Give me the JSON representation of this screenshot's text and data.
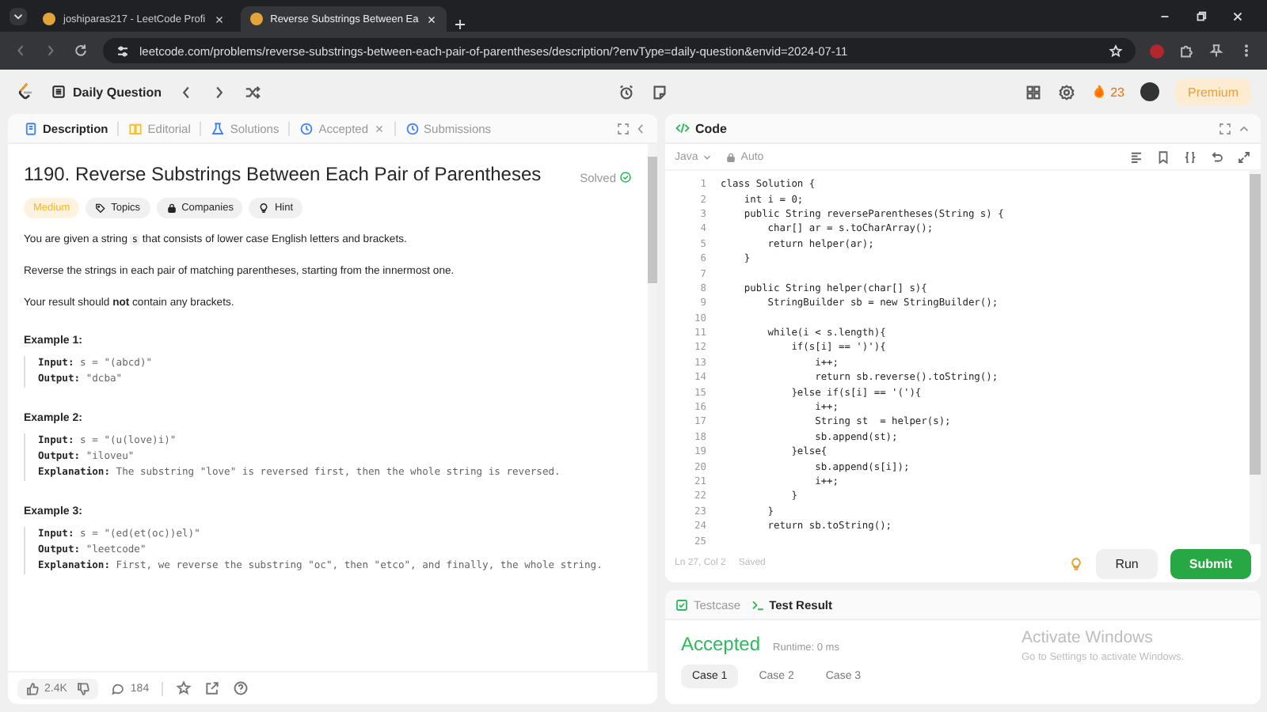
{
  "browser": {
    "tabs": [
      {
        "title": "joshiparas217 - LeetCode Profi",
        "selected": false
      },
      {
        "title": "Reverse Substrings Between Ea",
        "selected": true
      }
    ],
    "url": "leetcode.com/problems/reverse-substrings-between-each-pair-of-parentheses/description/?envType=daily-question&envid=2024-07-11"
  },
  "nav": {
    "title": "Daily Question",
    "streak": "23",
    "premium": "Premium"
  },
  "description_panel": {
    "tabs": [
      {
        "label": "Description",
        "selected": true,
        "closable": false
      },
      {
        "label": "Editorial",
        "selected": false,
        "closable": false
      },
      {
        "label": "Solutions",
        "selected": false,
        "closable": false
      },
      {
        "label": "Accepted",
        "selected": false,
        "closable": true
      },
      {
        "label": "Submissions",
        "selected": false,
        "closable": false
      }
    ],
    "title": "1190. Reverse Substrings Between Each Pair of Parentheses",
    "status": "Solved",
    "tags": [
      {
        "label": "Medium",
        "kind": "difficulty"
      },
      {
        "label": "Topics",
        "kind": "topics"
      },
      {
        "label": "Companies",
        "kind": "companies"
      },
      {
        "label": "Hint",
        "kind": "hint"
      }
    ],
    "paragraphs": [
      [
        {
          "kind": "text",
          "text": "You are given a string "
        },
        {
          "kind": "code",
          "text": "s"
        },
        {
          "kind": "text",
          "text": " that consists of lower case English letters and brackets."
        }
      ],
      [
        {
          "kind": "text",
          "text": "Reverse the strings in each pair of matching parentheses, starting from the innermost one."
        }
      ],
      [
        {
          "kind": "text",
          "text": "Your result should **not** contain any brackets."
        }
      ]
    ],
    "examples": [
      {
        "title": "Example 1:",
        "lines": [
          {
            "label": "Input:",
            "value": "s = \"(abcd)\""
          },
          {
            "label": "Output:",
            "value": "\"dcba\""
          }
        ]
      },
      {
        "title": "Example 2:",
        "lines": [
          {
            "label": "Input:",
            "value": "s = \"(u(love)i)\""
          },
          {
            "label": "Output:",
            "value": "\"iloveu\""
          },
          {
            "label": "Explanation:",
            "value": "The substring \"love\" is reversed first, then the whole string is reversed."
          }
        ]
      },
      {
        "title": "Example 3:",
        "lines": [
          {
            "label": "Input:",
            "value": "s = \"(ed(et(oc))el)\""
          },
          {
            "label": "Output:",
            "value": "\"leetcode\""
          },
          {
            "label": "Explanation:",
            "value": "First, we reverse the substring \"oc\", then \"etco\", and finally, the whole string."
          }
        ]
      }
    ],
    "footer": {
      "likes": "2.4K",
      "comments": "184"
    }
  },
  "code_panel": {
    "title": "Code",
    "language": "Java",
    "mode": "Auto",
    "lines": [
      {
        "number": "1",
        "text": "class Solution {"
      },
      {
        "number": "2",
        "text": "    int i = 0;"
      },
      {
        "number": "3",
        "text": "    public String reverseParentheses(String s) {"
      },
      {
        "number": "4",
        "text": "        char[] ar = s.toCharArray();"
      },
      {
        "number": "5",
        "text": "        return helper(ar);"
      },
      {
        "number": "6",
        "text": "    }"
      },
      {
        "number": "7"
      },
      {
        "number": "8",
        "text": "    public String helper(char[] s){"
      },
      {
        "number": "9",
        "text": "        StringBuilder sb = new StringBuilder();"
      },
      {
        "number": "10"
      },
      {
        "number": "11",
        "text": "        while(i < s.length){"
      },
      {
        "number": "12",
        "text": "            if(s[i] == ')'){"
      },
      {
        "number": "13",
        "text": "                i++;"
      },
      {
        "number": "14",
        "text": "                return sb.reverse().toString();"
      },
      {
        "number": "15",
        "text": "            }else if(s[i] == '('){"
      },
      {
        "number": "16",
        "text": "                i++;"
      },
      {
        "number": "17",
        "text": "                String st  = helper(s);"
      },
      {
        "number": "18",
        "text": "                sb.append(st);"
      },
      {
        "number": "19",
        "text": "            }else{"
      },
      {
        "number": "20",
        "text": "                sb.append(s[i]);"
      },
      {
        "number": "21",
        "text": "                i++;"
      },
      {
        "number": "22",
        "text": "            }"
      },
      {
        "number": "23",
        "text": "        }"
      },
      {
        "number": "24",
        "text": "        return sb.toString();"
      },
      {
        "number": "25"
      }
    ],
    "cursor": "Ln 27, Col 2",
    "saved": "Saved",
    "run": "Run",
    "submit": "Submit"
  },
  "result_panel": {
    "tabs": [
      {
        "label": "Testcase",
        "selected": false
      },
      {
        "label": "Test Result",
        "selected": true
      }
    ],
    "verdict": "Accepted",
    "runtime": "Runtime: 0 ms",
    "cases": [
      {
        "label": "Case 1",
        "selected": true
      },
      {
        "label": "Case 2",
        "selected": false
      },
      {
        "label": "Case 3",
        "selected": false
      }
    ]
  },
  "os_notice": {
    "title": "Activate Windows",
    "subtitle": "Go to Settings to activate Windows."
  }
}
